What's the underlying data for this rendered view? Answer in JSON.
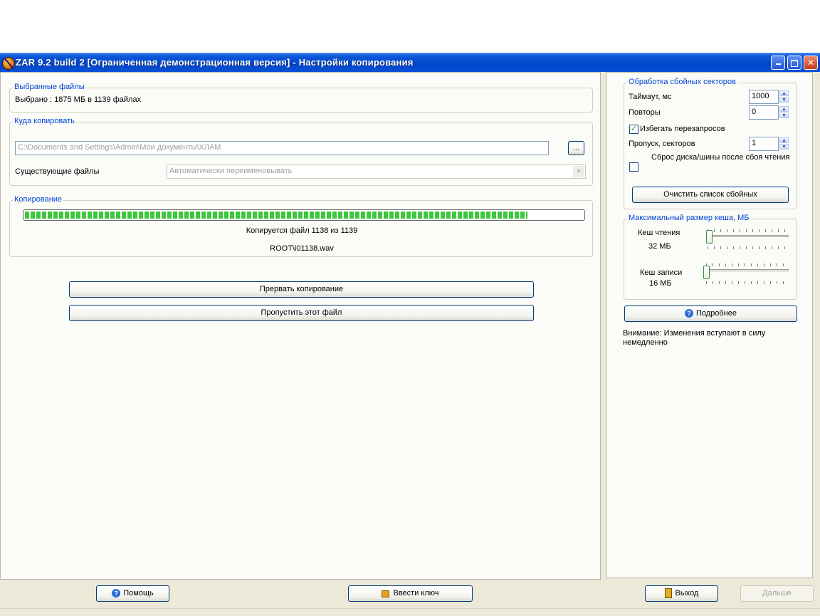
{
  "window": {
    "title": "ZAR 9.2 build 2 [Ограниченная демонстрационная версия] - Настройки копирования"
  },
  "selected_files": {
    "group_label": "Выбранные файлы",
    "summary": "Выбрано : 1875 МБ в 1139 файлах"
  },
  "destination": {
    "group_label": "Куда копировать",
    "path_value": "C:\\Documents and Settings\\Admin\\Мои документы\\ХЛАМ",
    "browse_label": "...",
    "existing_label": "Существующие файлы",
    "existing_value": "Автоматически переименовывать"
  },
  "copying": {
    "group_label": "Копирование",
    "progress_fraction": 0.9,
    "status": "Копируется файл 1138 из 1139",
    "current_file": "ROOT\\i01138.wav"
  },
  "actions": {
    "abort_label": "Прервать копирование",
    "skip_label": "Пропустить этот файл"
  },
  "bad_sectors": {
    "group_label": "Обработка сбойных секторов",
    "timeout_label": "Таймаут, мс",
    "timeout_value": "1000",
    "retries_label": "Повторы",
    "retries_value": "0",
    "avoid_label": "Избегать перезапросов",
    "avoid_checked": true,
    "skip_label": "Пропуск, секторов",
    "skip_value": "1",
    "reset_label": "Сброс диска/шины после сбоя чтения",
    "reset_checked": false,
    "clear_label": "Очистить список сбойных"
  },
  "cache": {
    "group_label": "Максимальный размер кеша, МБ",
    "read_label": "Кеш чтения",
    "read_value": "32 МБ",
    "write_label": "Кеш записи",
    "write_value": "16 МБ"
  },
  "more_label": "Подробнее",
  "notice": "Внимание: Изменения вступают в силу немедленно",
  "footer": {
    "help_label": "Помощь",
    "key_label": "Ввести ключ",
    "exit_label": "Выход",
    "next_label": "Дальше"
  },
  "colors": {
    "progress": "#3cc83c",
    "group_label": "#0046d5",
    "titlebar": "#0a55d6"
  }
}
